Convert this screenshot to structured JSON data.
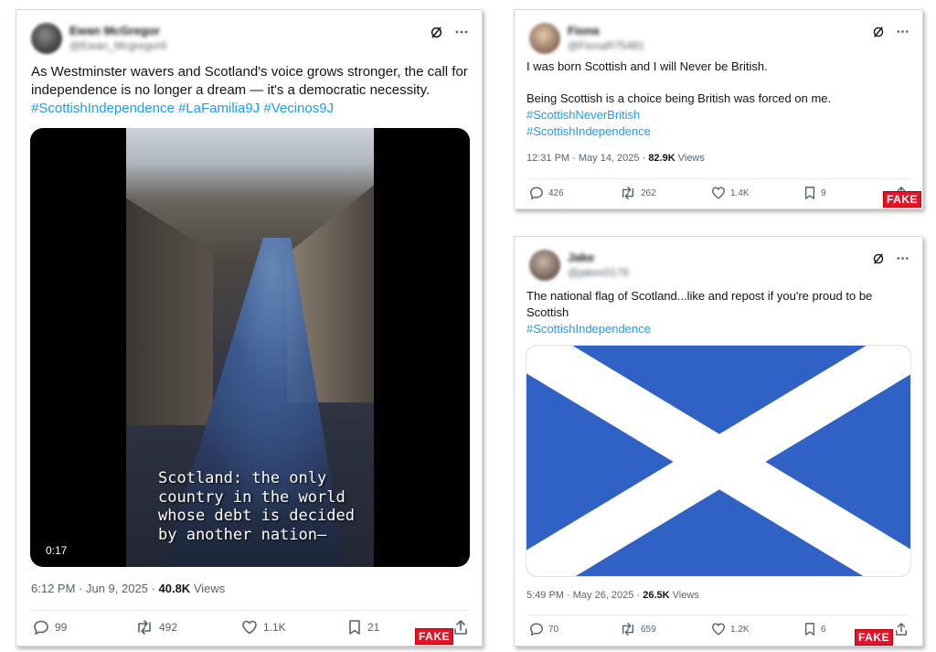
{
  "posts": [
    {
      "user": {
        "name": "Ewan McGregor",
        "handle": "@Ewan_Mcgregor8"
      },
      "text": "As Westminster wavers and Scotland's voice grows stronger, the call for independence is no longer a dream — it's a democratic necessity.",
      "hashtags": [
        "#ScottishIndependence",
        "#LaFamilia9J",
        "#Vecinos9J"
      ],
      "video": {
        "subtitle": "Scotland: the only\ncountry in the world\nwhose debt is decided\nby another nation—",
        "duration": "0:17"
      },
      "timestamp": "6:12 PM · Jun 9, 2025",
      "views_count": "40.8K",
      "views_label": "Views",
      "replies": "99",
      "reposts": "492",
      "likes": "1.1K",
      "bookmarks": "21",
      "badge": "FAKE"
    },
    {
      "user": {
        "name": "Fiona",
        "handle": "@FionaR75481"
      },
      "text_line1": "I was born Scottish and I will Never be British.",
      "text_line2": "Being Scottish is a choice being British was forced on me.",
      "hashtags": [
        "#ScottishNeverBritish",
        "#ScottishIndependence"
      ],
      "timestamp": "12:31 PM · May 14, 2025",
      "views_count": "82.9K",
      "views_label": "Views",
      "replies": "426",
      "reposts": "262",
      "likes": "1.4K",
      "bookmarks": "9",
      "badge": "FAKE"
    },
    {
      "user": {
        "name": "Jake",
        "handle": "@jakex0178"
      },
      "text": "The national flag of Scotland...like and repost if you're proud to be Scottish",
      "hashtags": [
        "#ScottishIndependence"
      ],
      "flag": {
        "field_color": "#2f62c4",
        "cross_color": "#ffffff"
      },
      "timestamp": "5:49 PM · May 26, 2025",
      "views_count": "26.5K",
      "views_label": "Views",
      "replies": "70",
      "reposts": "659",
      "likes": "1.2K",
      "bookmarks": "6",
      "badge": "FAKE"
    }
  ],
  "icons": {
    "grok": "grok-icon",
    "more": "more-icon",
    "reply": "reply-icon",
    "repost": "repost-icon",
    "like": "like-icon",
    "bookmark": "bookmark-icon",
    "share": "share-icon"
  },
  "colors": {
    "link": "#1d9bf0",
    "badge": "#e2132a",
    "muted": "#536471"
  }
}
